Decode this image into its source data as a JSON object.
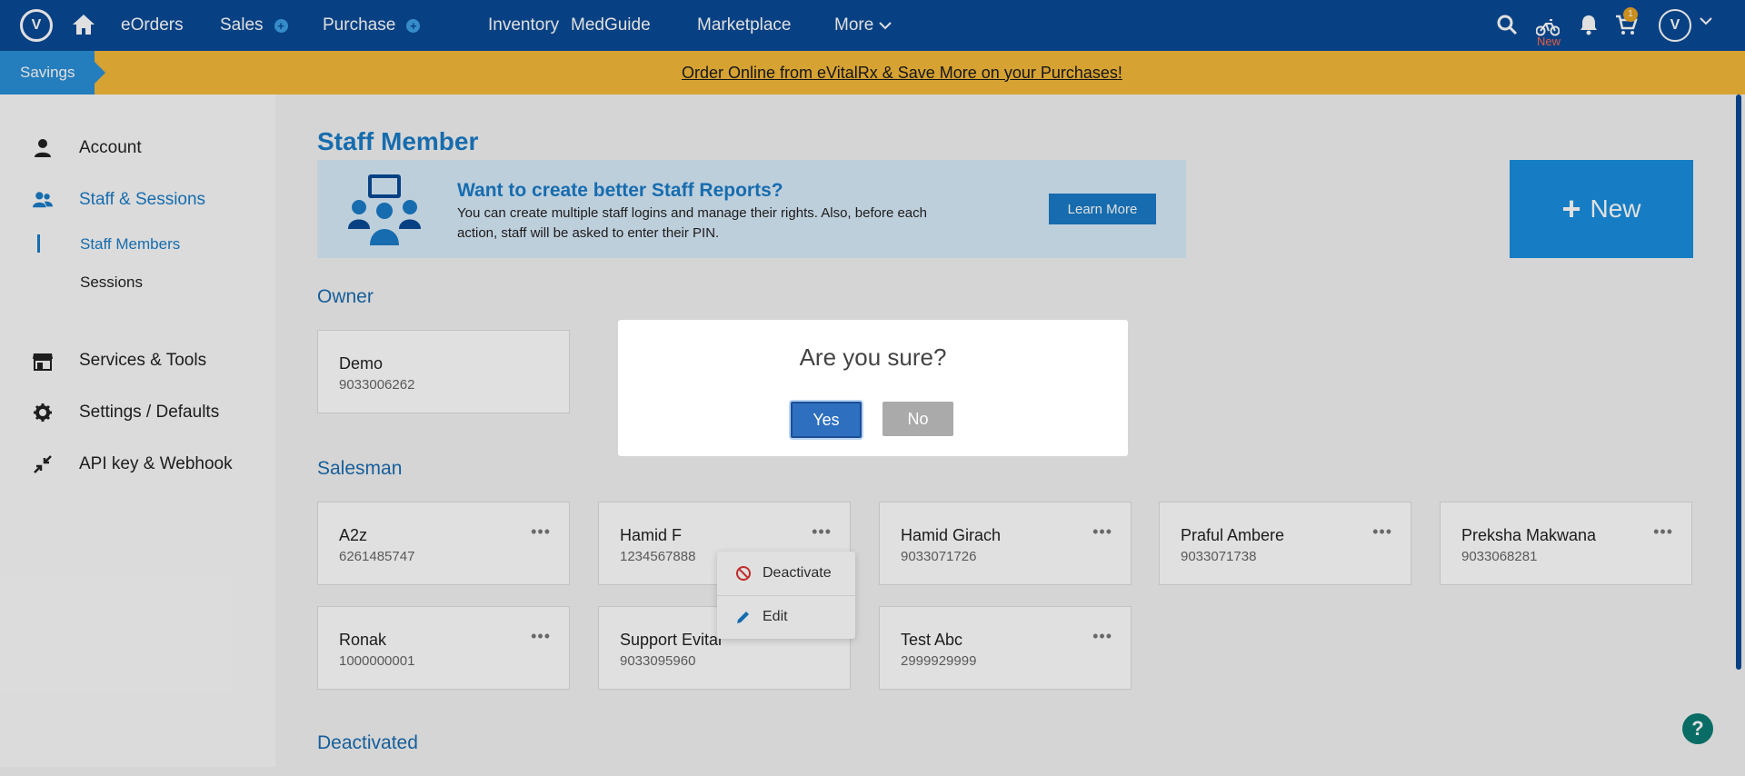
{
  "nav": {
    "items": [
      {
        "label": "eOrders"
      },
      {
        "label": "Sales",
        "plus": "+"
      },
      {
        "label": "Purchase",
        "plus": "+"
      },
      {
        "label": "Inventory"
      },
      {
        "label": "MedGuide"
      },
      {
        "label": "Marketplace"
      },
      {
        "label": "More",
        "chevron": "⌄"
      }
    ],
    "new_tag": "New",
    "cart_count": "1",
    "icons": [
      "search-icon",
      "bike-icon",
      "bell-icon",
      "cart-icon"
    ]
  },
  "banner": {
    "tab": "Savings",
    "link": "Order Online from eVitalRx & Save More on your Purchases!"
  },
  "sidebar": {
    "items": [
      {
        "label": "Account",
        "icon": "user-icon"
      },
      {
        "label": "Staff & Sessions",
        "icon": "users-icon",
        "active": true
      },
      {
        "label": "Services & Tools",
        "icon": "store-icon"
      },
      {
        "label": "Settings / Defaults",
        "icon": "gear-icon"
      },
      {
        "label": "API key & Webhook",
        "icon": "collapse-icon"
      }
    ],
    "sub": [
      {
        "label": "Staff Members",
        "active": true
      },
      {
        "label": "Sessions"
      }
    ]
  },
  "main": {
    "title": "Staff Member",
    "promo": {
      "heading": "Want to create better Staff Reports?",
      "text": "You can create multiple staff logins and manage their rights. Also, before each action, staff will be asked to enter their PIN.",
      "button": "Learn More"
    },
    "new_button": "New",
    "sections": {
      "owner": "Owner",
      "salesman": "Salesman",
      "deactivated": "Deactivated"
    },
    "owner": {
      "name": "Demo",
      "phone": "9033006262"
    },
    "salesmen": [
      {
        "name": "A2z",
        "phone": "6261485747"
      },
      {
        "name": "Hamid F",
        "phone": "1234567888"
      },
      {
        "name": "Hamid Girach",
        "phone": "9033071726"
      },
      {
        "name": "Praful Ambere",
        "phone": "9033071738"
      },
      {
        "name": "Preksha Makwana",
        "phone": "9033068281"
      },
      {
        "name": "Ronak",
        "phone": "1000000001"
      },
      {
        "name": "Support Evital",
        "phone": "9033095960"
      },
      {
        "name": "Test Abc",
        "phone": "2999929999"
      }
    ],
    "dots": "•••",
    "dropdown": {
      "deactivate": "Deactivate",
      "edit": "Edit"
    }
  },
  "modal": {
    "title": "Are you sure?",
    "yes": "Yes",
    "no": "No"
  },
  "help": "?",
  "colors": {
    "nav_bg": "#0a4a96",
    "banner_bg": "#f4b93a",
    "accent": "#1a7cc7",
    "help": "#0b7b74"
  }
}
